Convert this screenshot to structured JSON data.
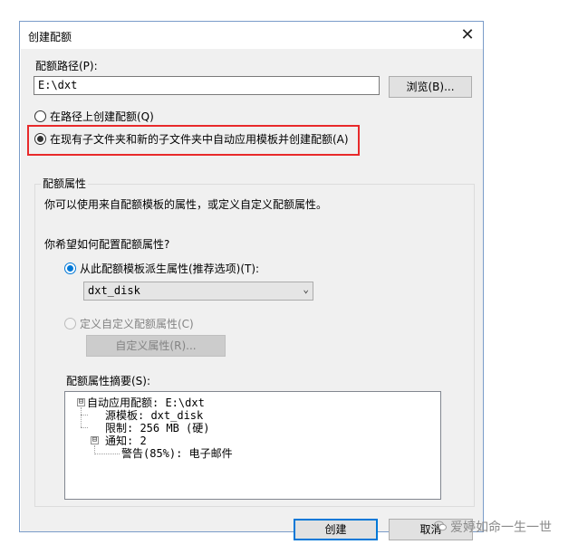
{
  "window": {
    "title": "创建配额",
    "close_glyph": "✕"
  },
  "path": {
    "label": "配额路径(P):",
    "value": "E:\\dxt",
    "browse_label": "浏览(B)..."
  },
  "options": {
    "create_on_path": "在路径上创建配额(Q)",
    "auto_apply": "在现有子文件夹和新的子文件夹中自动应用模板并创建配额(A)"
  },
  "properties": {
    "group_title": "配额属性",
    "description": "你可以使用来自配额模板的属性，或定义自定义配额属性。",
    "question": "你希望如何配置配额属性?",
    "derive_label": "从此配额模板派生属性(推荐选项)(T):",
    "template_selected": "dxt_disk",
    "custom_label": "定义自定义配额属性(C)",
    "custom_button": "自定义属性(R)...",
    "summary_label": "配额属性摘要(S):"
  },
  "summary_tree": [
    {
      "text": "自动应用配额: E:\\dxt",
      "expander": "⊟"
    },
    {
      "text": "源模板: dxt_disk"
    },
    {
      "text": "限制: 256 MB (硬)"
    },
    {
      "text": "通知: 2",
      "expander": "⊟"
    },
    {
      "text": "警告(85%): 电子邮件"
    }
  ],
  "footer": {
    "create_label": "创建",
    "cancel_label": "取消"
  },
  "watermark": {
    "text": "爱婷如命一生一世"
  },
  "colors": {
    "highlight": "#e8292a",
    "accent": "#0078d7"
  }
}
